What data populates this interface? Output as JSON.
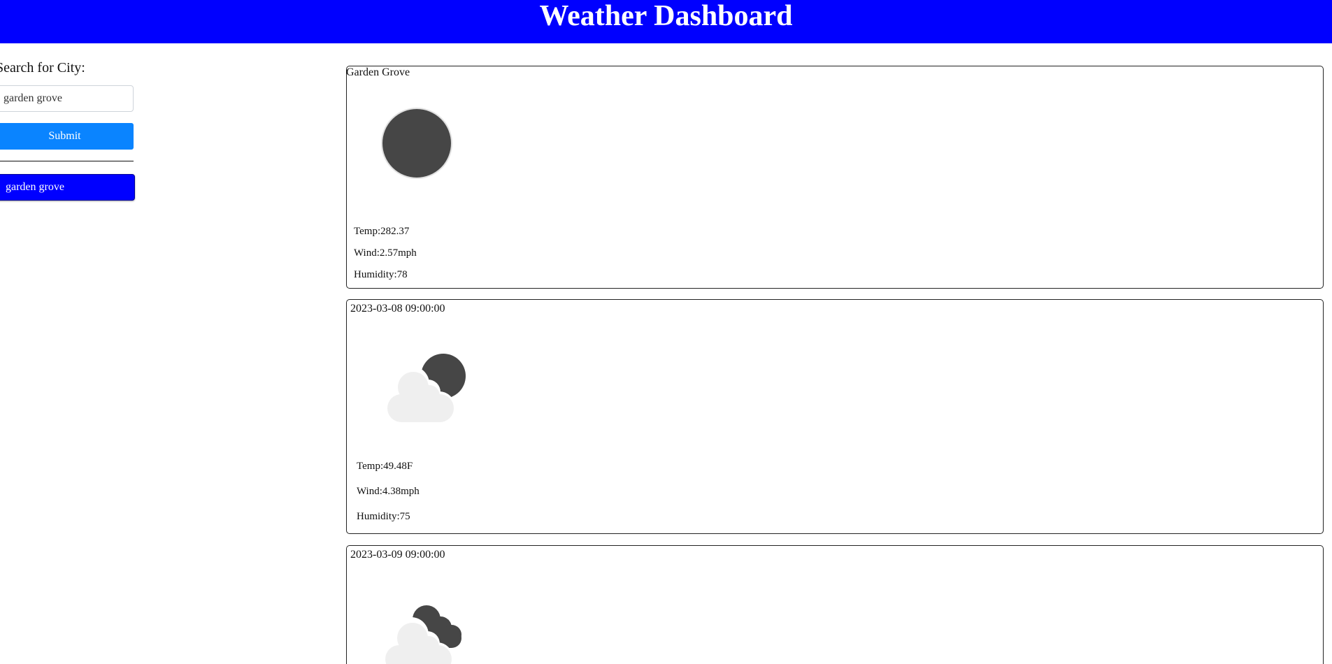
{
  "header": {
    "title": "Weather Dashboard"
  },
  "sidebar": {
    "search_label": "Search for City:",
    "search_value": "garden grove",
    "submit_label": "Submit",
    "history": [
      "garden grove"
    ]
  },
  "current": {
    "city": "Garden Grove",
    "icon": "dark-moon-icon",
    "temp": "Temp:282.37",
    "wind": "Wind:2.57mph",
    "humidity": "Humidity:78"
  },
  "forecast": [
    {
      "date": "2023-03-08 09:00:00",
      "icon": "partly-cloudy-night-icon",
      "temp": "Temp:49.48F",
      "wind": "Wind:4.38mph",
      "humidity": "Humidity:75"
    },
    {
      "date": "2023-03-09 09:00:00",
      "icon": "cloudy-night-icon"
    }
  ],
  "colors": {
    "header_bg": "#0000ff",
    "submit_bg": "#0a84ff",
    "history_bg": "#0000ff",
    "icon_dark": "#464646",
    "icon_cloud": "#efefef"
  }
}
